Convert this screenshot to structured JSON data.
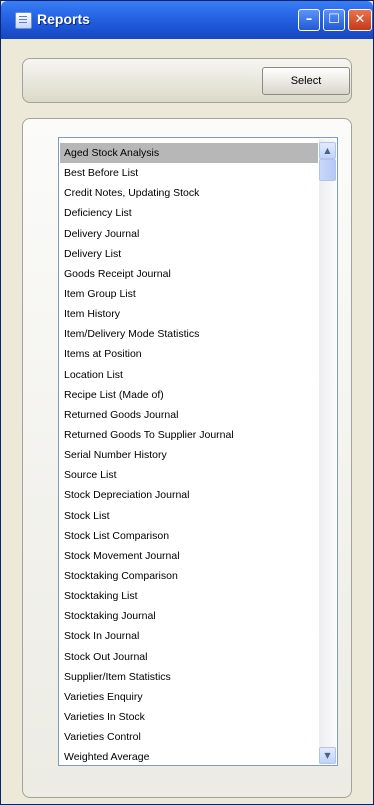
{
  "window": {
    "title": "Reports",
    "icon": "report-window-icon"
  },
  "titlebar_buttons": {
    "minimize": "minimize-icon",
    "maximize": "maximize-icon",
    "close": "close-icon"
  },
  "toolbar": {
    "select_label": "Select"
  },
  "report_list": {
    "selected": "Aged Stock Analysis",
    "items": [
      "Aged Stock Analysis",
      "Best Before List",
      "Credit Notes, Updating Stock",
      "Deficiency List",
      "Delivery Journal",
      "Delivery List",
      "Goods Receipt Journal",
      "Item Group List",
      "Item History",
      "Item/Delivery Mode Statistics",
      "Items at Position",
      "Location List",
      "Recipe List (Made of)",
      "Returned Goods Journal",
      "Returned Goods To Supplier Journal",
      "Serial Number History",
      "Source List",
      "Stock Depreciation Journal",
      "Stock List",
      "Stock List Comparison",
      "Stock Movement Journal",
      "Stocktaking Comparison",
      "Stocktaking List",
      "Stocktaking Journal",
      "Stock In Journal",
      "Stock Out Journal",
      "Supplier/Item Statistics",
      "Varieties Enquiry",
      "Varieties In Stock",
      "Varieties Control",
      "Weighted Average"
    ]
  },
  "colors": {
    "titlebar": "#2a6ae8",
    "selection": "#b7b7b7",
    "list_border": "#7f9db9"
  }
}
